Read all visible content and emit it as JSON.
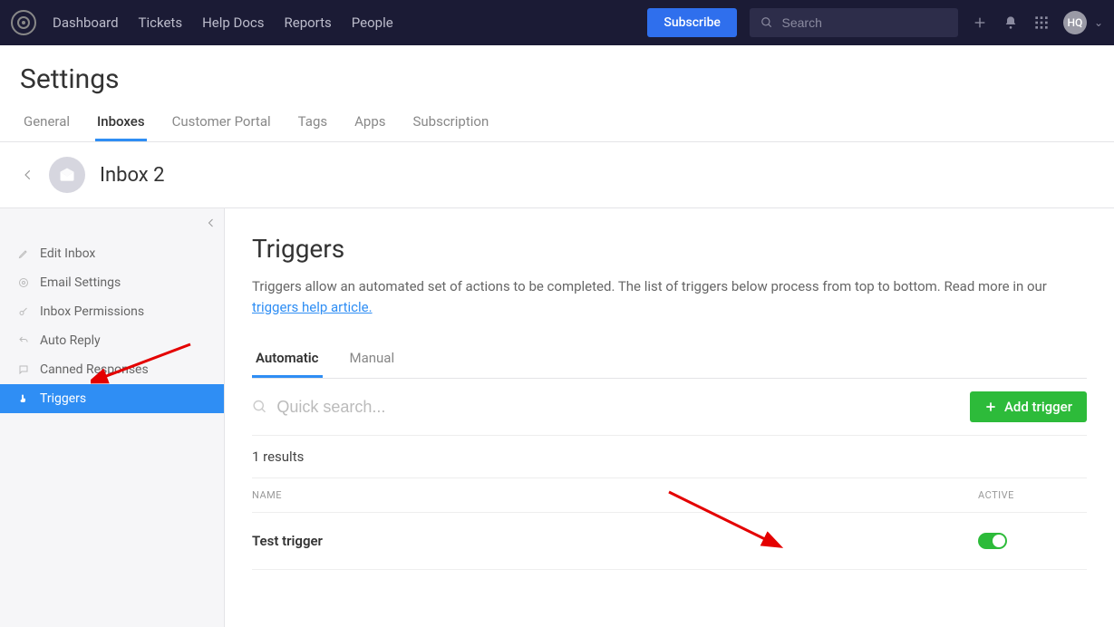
{
  "topbar": {
    "nav": [
      "Dashboard",
      "Tickets",
      "Help Docs",
      "Reports",
      "People"
    ],
    "subscribe": "Subscribe",
    "search_placeholder": "Search",
    "avatar": "HQ"
  },
  "page_title": "Settings",
  "settings_tabs": [
    "General",
    "Inboxes",
    "Customer Portal",
    "Tags",
    "Apps",
    "Subscription"
  ],
  "settings_active_tab": 1,
  "inbox": {
    "name": "Inbox 2"
  },
  "sidebar": {
    "items": [
      {
        "icon": "pencil",
        "label": "Edit Inbox"
      },
      {
        "icon": "at",
        "label": "Email Settings"
      },
      {
        "icon": "key",
        "label": "Inbox Permissions"
      },
      {
        "icon": "reply",
        "label": "Auto Reply"
      },
      {
        "icon": "chat",
        "label": "Canned Responses"
      },
      {
        "icon": "hand",
        "label": "Triggers"
      }
    ],
    "active_index": 5
  },
  "triggers": {
    "heading": "Triggers",
    "description": "Triggers allow an automated set of actions to be completed. The list of triggers below process from top to bottom. Read more in our ",
    "help_link_text": "triggers help article.",
    "tabs": [
      "Automatic",
      "Manual"
    ],
    "active_tab": 0,
    "quick_search_placeholder": "Quick search...",
    "add_button": "Add trigger",
    "results_text": "1 results",
    "columns": {
      "name": "NAME",
      "active": "ACTIVE"
    },
    "rows": [
      {
        "name": "Test trigger",
        "active": true
      }
    ]
  }
}
